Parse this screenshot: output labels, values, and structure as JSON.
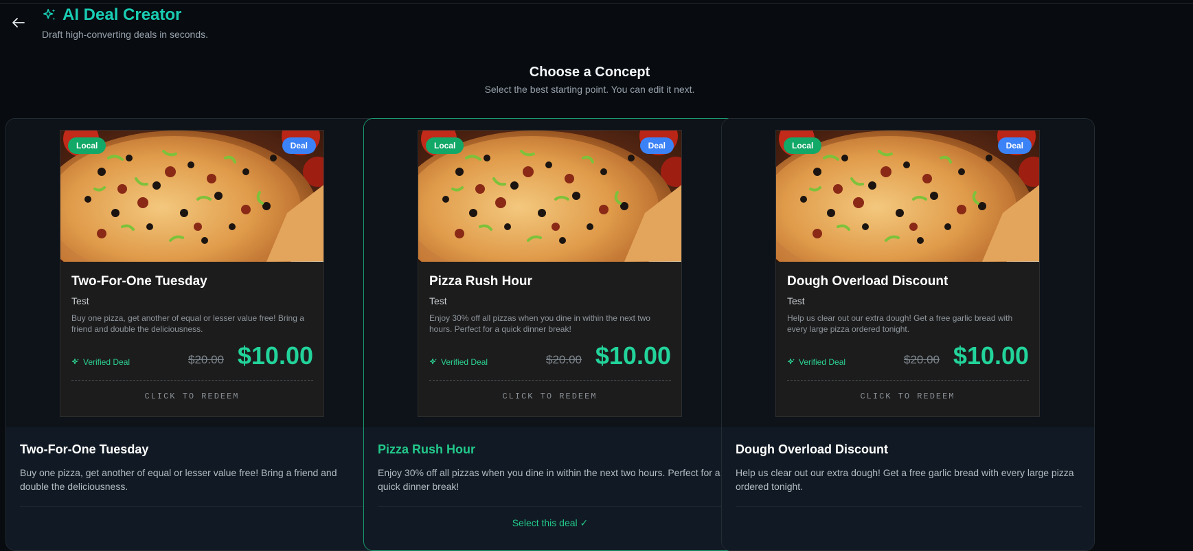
{
  "header": {
    "title": "AI Deal Creator",
    "subtitle": "Draft high-converting deals in seconds.",
    "back_icon": "arrow-left-icon",
    "title_icon": "sparkles-icon"
  },
  "section": {
    "heading": "Choose a Concept",
    "description": "Select the best starting point. You can edit it next."
  },
  "colors": {
    "accent": "#19cdb4",
    "price": "#22d39a",
    "local_badge": "#12a868",
    "deal_badge": "#3b82f6"
  },
  "cards": [
    {
      "badge_left": "Local",
      "badge_right": "Deal",
      "preview_title": "Two-For-One Tuesday",
      "preview_subtitle": "Test",
      "preview_description": "Buy one pizza, get another of equal or lesser value free! Bring a friend and double the deliciousness.",
      "verified_label": "Verified Deal",
      "old_price": "$20.00",
      "new_price": "$10.00",
      "redeem_label": "CLICK TO REDEEM",
      "title": "Two-For-One Tuesday",
      "description": "Buy one pizza, get another of equal or lesser value free! Bring a friend and double the deliciousness.",
      "selected": false,
      "select_label": ""
    },
    {
      "badge_left": "Local",
      "badge_right": "Deal",
      "preview_title": "Pizza Rush Hour",
      "preview_subtitle": "Test",
      "preview_description": "Enjoy 30% off all pizzas when you dine in within the next two hours. Perfect for a quick dinner break!",
      "verified_label": "Verified Deal",
      "old_price": "$20.00",
      "new_price": "$10.00",
      "redeem_label": "CLICK TO REDEEM",
      "title": "Pizza Rush Hour",
      "description": "Enjoy 30% off all pizzas when you dine in within the next two hours. Perfect for a quick dinner break!",
      "selected": true,
      "select_label": "Select this deal ✓"
    },
    {
      "badge_left": "Local",
      "badge_right": "Deal",
      "preview_title": "Dough Overload Discount",
      "preview_subtitle": "Test",
      "preview_description": "Help us clear out our extra dough! Get a free garlic bread with every large pizza ordered tonight.",
      "verified_label": "Verified Deal",
      "old_price": "$20.00",
      "new_price": "$10.00",
      "redeem_label": "CLICK TO REDEEM",
      "title": "Dough Overload Discount",
      "description": "Help us clear out our extra dough! Get a free garlic bread with every large pizza ordered tonight.",
      "selected": false,
      "select_label": ""
    }
  ]
}
